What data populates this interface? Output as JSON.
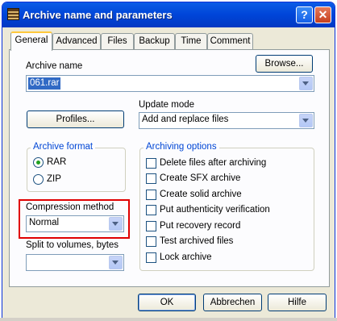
{
  "window": {
    "title": "Archive name and parameters",
    "help_glyph": "?",
    "close_glyph": "✕"
  },
  "tabs": [
    "General",
    "Advanced",
    "Files",
    "Backup",
    "Time",
    "Comment"
  ],
  "archive_name": {
    "label": "Archive name",
    "value": "061.rar",
    "browse_label": "Browse..."
  },
  "update_mode": {
    "label": "Update mode",
    "value": "Add and replace files"
  },
  "profiles_label": "Profiles...",
  "archive_format": {
    "title": "Archive format",
    "options": [
      "RAR",
      "ZIP"
    ],
    "selected": "RAR"
  },
  "compression": {
    "label": "Compression method",
    "value": "Normal"
  },
  "split": {
    "label": "Split to volumes, bytes",
    "value": ""
  },
  "archiving_options": {
    "title": "Archiving options",
    "items": [
      "Delete files after archiving",
      "Create SFX archive",
      "Create solid archive",
      "Put authenticity verification",
      "Put recovery record",
      "Test archived files",
      "Lock archive"
    ]
  },
  "buttons": {
    "ok": "OK",
    "cancel": "Abbrechen",
    "help": "Hilfe"
  },
  "colors": {
    "highlight": "#e00000",
    "titlebar": "#0045d8",
    "selection": "#316ac5"
  }
}
